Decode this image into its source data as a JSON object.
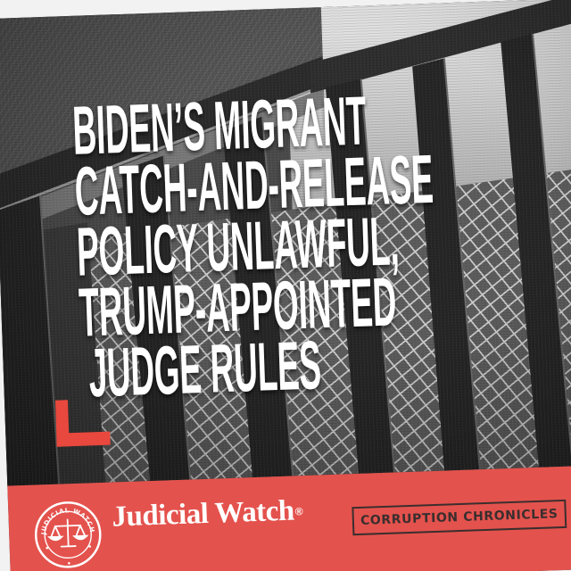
{
  "headline": {
    "lines": [
      "BIDEN’S MIGRANT",
      "CATCH-AND-RELEASE",
      "POLICY UNLAWFUL,",
      "TRUMP-APPOINTED",
      "JUDGE RULES"
    ]
  },
  "footer": {
    "logo": {
      "seal_text": "JUDICIAL WATCH",
      "icon": "scales-of-justice-icon"
    },
    "brand_name": "Judicial Watch",
    "registered_mark": "®",
    "badge_label": "CORRUPTION CHRONICLES"
  },
  "colors": {
    "accent_red": "#e4524d",
    "corner_bracket": "#e8483d",
    "headline_text": "#ffffff",
    "badge_text": "#3a2e2e"
  }
}
